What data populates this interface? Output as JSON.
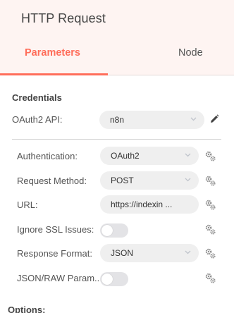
{
  "panel": {
    "title": "HTTP Request",
    "tabs": [
      {
        "label": "Parameters",
        "active": true
      },
      {
        "label": "Node",
        "active": false
      }
    ]
  },
  "credentials": {
    "section_title": "Credentials",
    "oauth2_label": "OAuth2 API:",
    "oauth2_value": "n8n"
  },
  "parameters": {
    "authentication_label": "Authentication:",
    "authentication_value": "OAuth2",
    "request_method_label": "Request Method:",
    "request_method_value": "POST",
    "url_label": "URL:",
    "url_value": "https://indexin ...",
    "ignore_ssl_label": "Ignore SSL Issues:",
    "ignore_ssl_value": false,
    "response_format_label": "Response Format:",
    "response_format_value": "JSON",
    "json_raw_label": "JSON/RAW Param...",
    "json_raw_value": false
  },
  "options": {
    "label": "Options:"
  },
  "colors": {
    "accent": "#ff6d5a",
    "header_bg": "#fef4f2",
    "field_bg": "#efefef",
    "toggle_off": "#e3e3e6"
  },
  "icons": [
    "pencil-icon",
    "gear-icon",
    "chevron-down-icon"
  ]
}
